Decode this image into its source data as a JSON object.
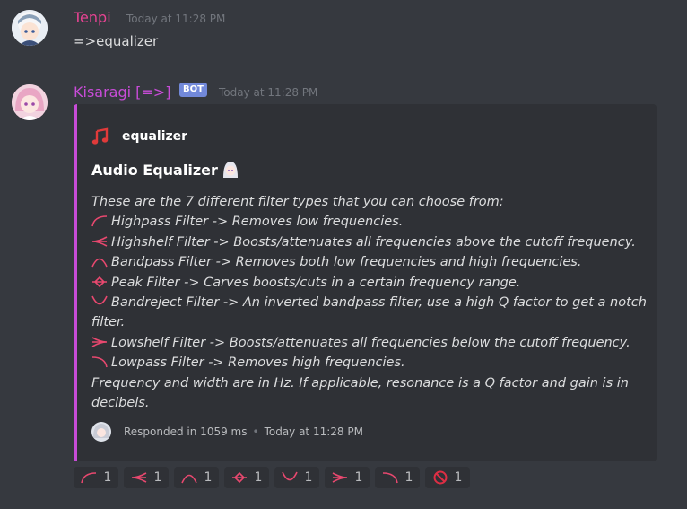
{
  "messages": [
    {
      "author": "Tenpi",
      "author_color": "#e84393",
      "timestamp": "Today at 11:28 PM",
      "text": "=>equalizer"
    },
    {
      "author": "Kisaragi [=>]",
      "author_color": "#c84cd8",
      "badge": "BOT",
      "timestamp": "Today at 11:28 PM"
    }
  ],
  "embed": {
    "accent": "#c84cd8",
    "author_icon": "music-note-icon",
    "author": "equalizer",
    "title": "Audio Equalizer",
    "title_icon": "anime-girl-emoji",
    "intro": "These are the 7 different filter types that you can choose from:",
    "filters": [
      {
        "icon": "highpass-icon",
        "text": "Highpass Filter -> Removes low frequencies."
      },
      {
        "icon": "highshelf-icon",
        "text": "Highshelf Filter -> Boosts/attenuates all frequencies above the cutoff frequency."
      },
      {
        "icon": "bandpass-icon",
        "text": "Bandpass Filter -> Removes both low frequencies and high frequencies."
      },
      {
        "icon": "peak-icon",
        "text": "Peak Filter -> Carves boosts/cuts in a certain frequency range."
      },
      {
        "icon": "bandreject-icon",
        "text": "Bandreject Filter -> An inverted bandpass filter, use a high Q factor to get a notch filter."
      },
      {
        "icon": "lowshelf-icon",
        "text": "Lowshelf Filter -> Boosts/attenuates all frequencies below the cutoff frequency."
      },
      {
        "icon": "lowpass-icon",
        "text": "Lowpass Filter -> Removes high frequencies."
      }
    ],
    "outro": "Frequency and width are in Hz. If applicable, resonance is a Q factor and gain is in decibels.",
    "footer_text": "Responded in 1059 ms",
    "footer_sep": "•",
    "footer_time": "Today at 11:28 PM"
  },
  "reactions": [
    {
      "icon": "highpass-icon",
      "count": "1"
    },
    {
      "icon": "highshelf-icon",
      "count": "1"
    },
    {
      "icon": "bandpass-icon",
      "count": "1"
    },
    {
      "icon": "peak-icon",
      "count": "1"
    },
    {
      "icon": "bandreject-icon",
      "count": "1"
    },
    {
      "icon": "lowshelf-icon",
      "count": "1"
    },
    {
      "icon": "lowpass-icon",
      "count": "1"
    },
    {
      "icon": "no-entry-icon",
      "count": "1"
    }
  ]
}
